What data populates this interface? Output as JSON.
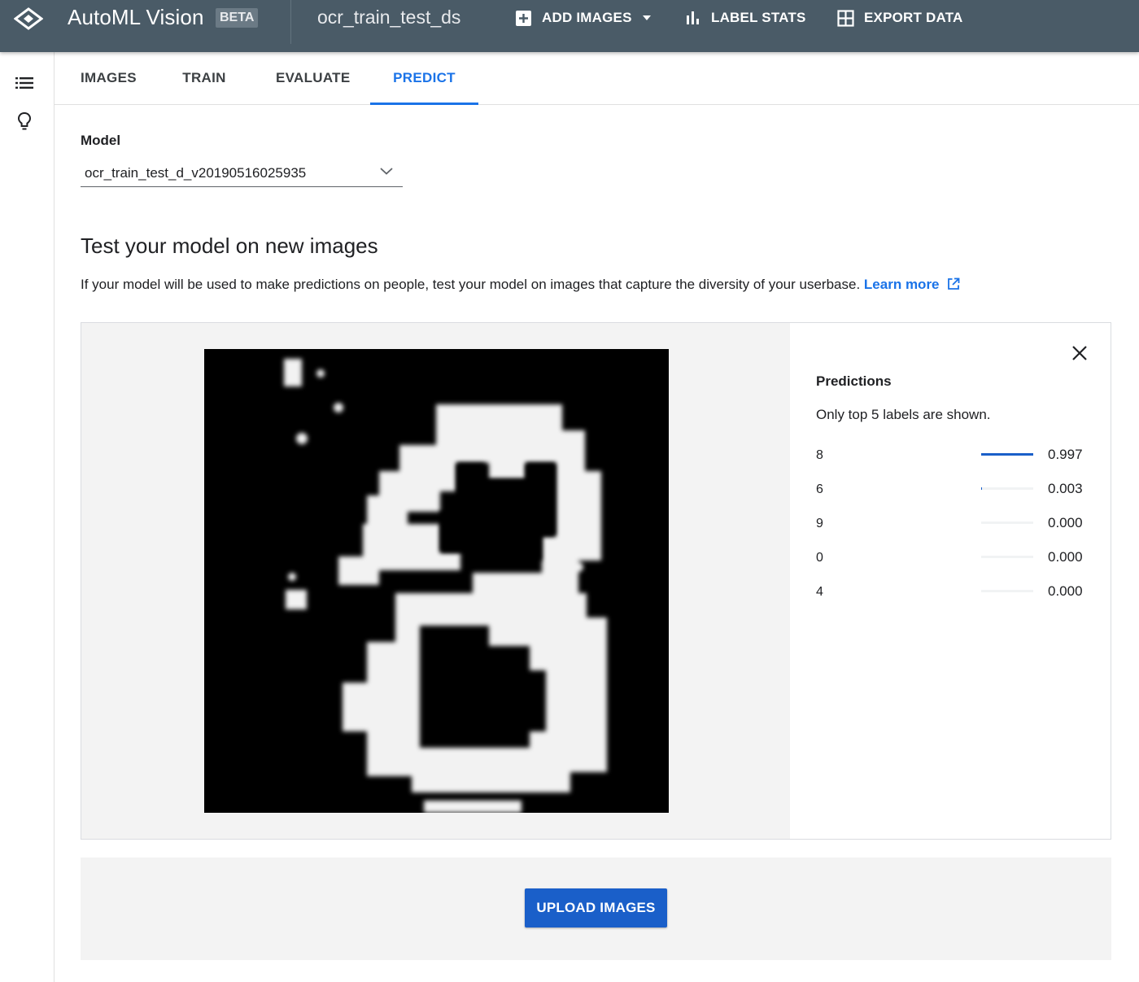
{
  "appbar": {
    "title": "AutoML Vision",
    "badge": "BETA",
    "dataset": "ocr_train_test_ds",
    "actions": [
      {
        "label": "ADD IMAGES",
        "icon": "add-box-icon"
      },
      {
        "label": "LABEL STATS",
        "icon": "bar-chart-icon"
      },
      {
        "label": "EXPORT DATA",
        "icon": "grid-icon"
      }
    ],
    "colors": {
      "bar": "#4a5b67",
      "accent": "#1a73e8",
      "button": "#1a5fc9"
    }
  },
  "rail": {
    "icons": [
      "list-icon",
      "lightbulb-icon"
    ]
  },
  "tabs": [
    {
      "label": "IMAGES",
      "active": false
    },
    {
      "label": "TRAIN",
      "active": false
    },
    {
      "label": "EVALUATE",
      "active": false
    },
    {
      "label": "PREDICT",
      "active": true
    }
  ],
  "model": {
    "label": "Model",
    "selected": "ocr_train_test_d_v20190516025935"
  },
  "section": {
    "title": "Test your model on new images",
    "description": "If your model will be used to make predictions on people, test your model on images that capture the diversity of your userbase.",
    "learn_more": "Learn more"
  },
  "predictions": {
    "title": "Predictions",
    "note": "Only top 5 labels are shown.",
    "items": [
      {
        "label": "8",
        "score": "0.997",
        "value": 0.997
      },
      {
        "label": "6",
        "score": "0.003",
        "value": 0.003
      },
      {
        "label": "9",
        "score": "0.000",
        "value": 0.0
      },
      {
        "label": "0",
        "score": "0.000",
        "value": 0.0
      },
      {
        "label": "4",
        "score": "0.000",
        "value": 0.0
      }
    ]
  },
  "upload": {
    "label": "UPLOAD IMAGES"
  }
}
